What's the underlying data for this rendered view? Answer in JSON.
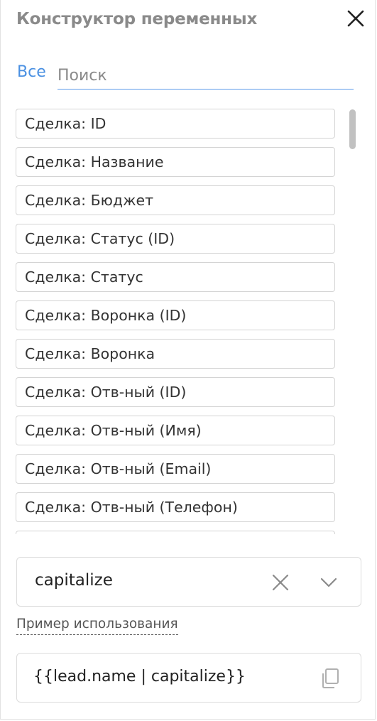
{
  "header": {
    "title": "Конструктор переменных",
    "close_icon": "close-icon"
  },
  "filter": {
    "tab_all": "Все",
    "search_placeholder": "Поиск",
    "search_value": ""
  },
  "variables": {
    "items": [
      "Сделка: ID",
      "Сделка: Название",
      "Сделка: Бюджет",
      "Сделка: Статус (ID)",
      "Сделка: Статус",
      "Сделка: Воронка (ID)",
      "Сделка: Воронка",
      "Сделка: Отв-ный (ID)",
      "Сделка: Отв-ный (Имя)",
      "Сделка: Отв-ный (Email)",
      "Сделка: Отв-ный (Телефон)",
      ""
    ]
  },
  "modifier": {
    "selected": "capitalize",
    "clear_icon": "clear-icon",
    "dropdown_icon": "chevron-down-icon"
  },
  "example": {
    "label": "Пример использования",
    "code": "{{lead.name | capitalize}}",
    "copy_icon": "copy-icon"
  },
  "colors": {
    "accent": "#4a90e2",
    "title": "#8a8a8a",
    "border": "#d4d4d4"
  }
}
